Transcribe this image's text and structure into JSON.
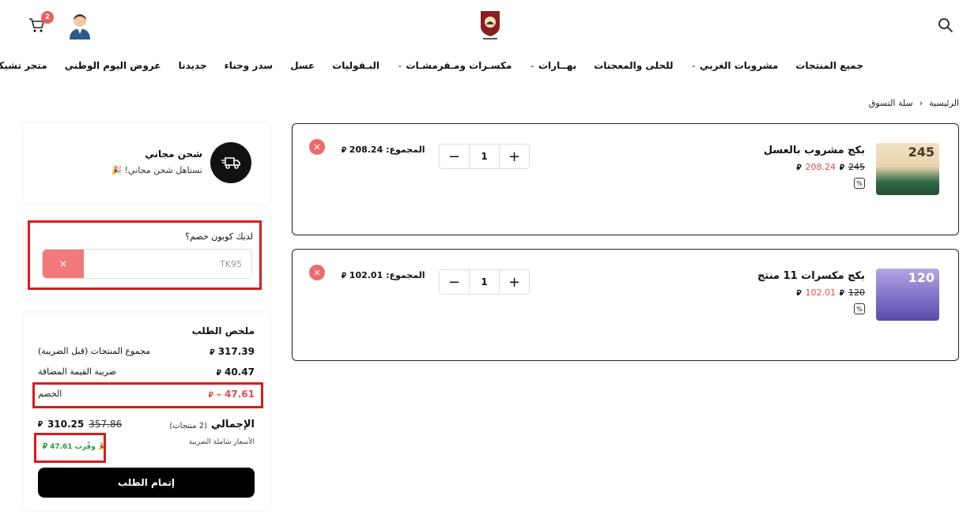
{
  "header": {
    "cart_count": "2",
    "icons": {
      "cart": "cart-icon",
      "avatar": "user-avatar",
      "search": "search-icon",
      "logo": "store-logo"
    }
  },
  "nav": {
    "items": [
      {
        "label": "متجر تشيكي",
        "dropdown": false
      },
      {
        "label": "عروض اليوم الوطني",
        "dropdown": false
      },
      {
        "label": "جديدنا",
        "dropdown": false
      },
      {
        "label": "سدر وحناء",
        "dropdown": false
      },
      {
        "label": "عسل",
        "dropdown": false
      },
      {
        "label": "البـقوليات",
        "dropdown": false
      },
      {
        "label": "مكسـرات ومـقرمشـات",
        "dropdown": true
      },
      {
        "label": "بهــارات",
        "dropdown": true
      },
      {
        "label": "للحلى والمعجنات",
        "dropdown": false
      },
      {
        "label": "مشروبات الغربي",
        "dropdown": true
      },
      {
        "label": "جميع المنتجات",
        "dropdown": false
      }
    ]
  },
  "breadcrumb": {
    "home": "الرئيسية",
    "separator": "›",
    "current": "سلة التسوق"
  },
  "cart": {
    "currency_symbol": "⃁",
    "items": [
      {
        "name": "بكج مشروب بالعسل",
        "old_price": "245",
        "new_price": "208.24",
        "quantity": "1",
        "total_label": "المجموع:",
        "total": "208.24",
        "thumb_text": "245"
      },
      {
        "name": "بكج مكسرات 11 منتج",
        "old_price": "120",
        "new_price": "102.01",
        "quantity": "1",
        "total_label": "المجموع:",
        "total": "102.01",
        "thumb_text": "120"
      }
    ]
  },
  "shipping": {
    "title": "شحن مجاني",
    "subtitle": "تستاهل شحن مجاني! 🎉"
  },
  "coupon": {
    "title": "لديك كوبون خصم؟",
    "value": "TK95",
    "clear_label": "×"
  },
  "summary": {
    "title": "ملخص الطلب",
    "subtotal_label": "مجموع المنتجات (قبل الضريبة)",
    "subtotal": "317.39",
    "vat_label": "ضريبة القيمة المضافة",
    "vat": "40.47",
    "discount_label": "الخصم",
    "discount": "– 47.61",
    "total_label": "الإجمالي",
    "total_count": "(2 منتجات)",
    "total_old": "357.86",
    "total": "310.25",
    "tax_note": "الأسعار شاملة الضريبة",
    "saved": "🎉 وفّرت 47.61",
    "checkout": "إتمام الطلب"
  },
  "colors": {
    "accent_red": "#e84a4a",
    "saved_green": "#1e9e4a",
    "button_black": "#000000",
    "highlight_red": "#d91c1c"
  }
}
